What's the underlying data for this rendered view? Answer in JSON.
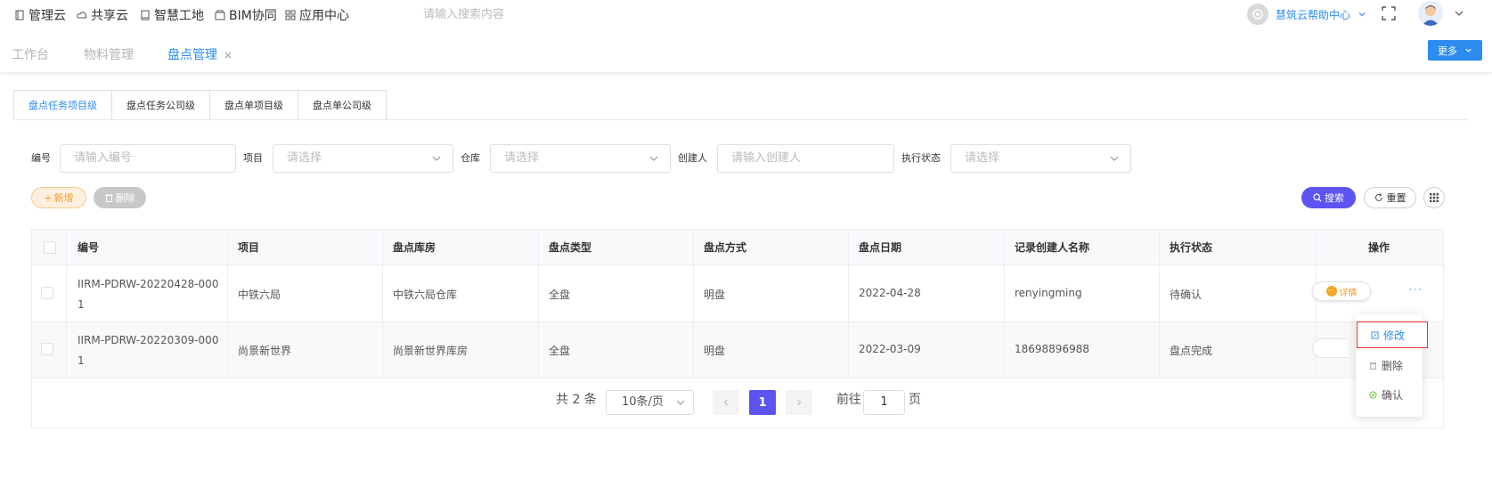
{
  "topnav": {
    "items": [
      "管理云",
      "共享云",
      "智慧工地",
      "BIM协同",
      "应用中心"
    ],
    "search_placeholder": "请输入搜索内容",
    "help_label": "慧筑云帮助中心"
  },
  "page_tabs": {
    "items": [
      "工作台",
      "物料管理",
      "盘点管理"
    ],
    "close": "×",
    "more_label": "更多"
  },
  "sub_tabs": [
    "盘点任务项目级",
    "盘点任务公司级",
    "盘点单项目级",
    "盘点单公司级"
  ],
  "filters": {
    "code_label": "编号",
    "code_placeholder": "请输入编号",
    "project_label": "项目",
    "project_placeholder": "请选择",
    "warehouse_label": "仓库",
    "warehouse_placeholder": "请选择",
    "creator_label": "创建人",
    "creator_placeholder": "请输入创建人",
    "status_label": "执行状态",
    "status_placeholder": "请选择"
  },
  "toolbar": {
    "add_label": "新增",
    "delete_label": "删除",
    "search_label": "搜索",
    "reset_label": "重置"
  },
  "table": {
    "columns": [
      "编号",
      "项目",
      "盘点库房",
      "盘点类型",
      "盘点方式",
      "盘点日期",
      "记录创建人名称",
      "执行状态",
      "操作"
    ],
    "rows": [
      {
        "code_line1": "IIRM-PDRW-20220428-000",
        "code_line2": "1",
        "project": "中铁六局",
        "warehouse": "中铁六局仓库",
        "type": "全盘",
        "method": "明盘",
        "date": "2022-04-28",
        "creator": "renyingming",
        "status": "待确认"
      },
      {
        "code_line1": "IIRM-PDRW-20220309-000",
        "code_line2": "1",
        "project": "尚景新世界",
        "warehouse": "尚景新世界库房",
        "type": "全盘",
        "method": "明盘",
        "date": "2022-03-09",
        "creator": "18698896988",
        "status": "盘点完成"
      }
    ],
    "detail_label": "详情",
    "more_dots": "···"
  },
  "pagination": {
    "total_text": "共 2 条",
    "page_size": "10条/页",
    "current_page": "1",
    "goto_label": "前往",
    "goto_value": "1",
    "page_unit": "页"
  },
  "dropdown": {
    "items": [
      "修改",
      "删除",
      "确认"
    ]
  },
  "colors": {
    "primary": "#2d8cf0",
    "accent": "#5b54f0",
    "warning": "#f29a2e",
    "highlight_border": "#e0302a"
  }
}
